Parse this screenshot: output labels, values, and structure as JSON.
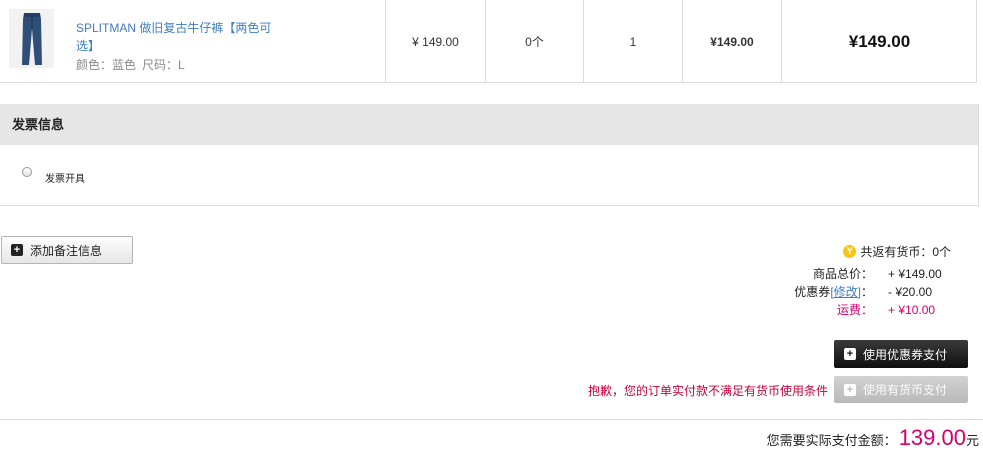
{
  "product": {
    "name": "SPLITMAN 做旧复古牛仔裤【两色可选】",
    "color_label": "颜色：蓝色",
    "size_label": "尺码：L",
    "unit_price": "¥ 149.00",
    "coins": "0个",
    "quantity": "1",
    "subtotal": "¥149.00",
    "total": "¥149.00"
  },
  "invoice": {
    "title": "发票信息",
    "option_label": "发票开具"
  },
  "note_button": "添加备注信息",
  "summary": {
    "coin_return": "共返有货币：0个",
    "goods_total_label": "商品总价：",
    "goods_total_value": "+ ¥149.00",
    "coupon_label": "优惠券",
    "coupon_modify": "[修改]",
    "coupon_colon": "：",
    "coupon_value": "- ¥20.00",
    "shipping_label": "运费：",
    "shipping_value": "+ ¥10.00"
  },
  "buttons": {
    "use_coupon": "使用优惠券支付",
    "use_coin": "使用有货币支付"
  },
  "warning": "抱歉，您的订单实付款不满足有货币使用条件",
  "payment": {
    "label": "您需要实际支付金额：",
    "amount": "139.00",
    "unit": "元"
  },
  "colors": {
    "accent_pink": "#d4006d",
    "link_blue": "#3f7ec2",
    "warning_red": "#c8003c"
  },
  "icons": [
    "jeans-thumbnail",
    "plus-icon",
    "coin-icon"
  ]
}
